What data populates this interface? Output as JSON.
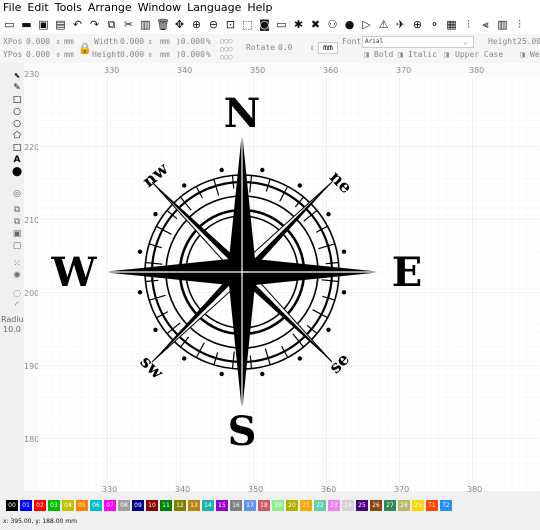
{
  "menu": [
    "File",
    "Edit",
    "Tools",
    "Arrange",
    "Window",
    "Language",
    "Help"
  ],
  "toolbar_icons": [
    "new-icon",
    "open-icon",
    "save-icon",
    "save-as-icon",
    "undo-icon",
    "redo-icon",
    "copy-icon",
    "cut-icon",
    "paste-icon",
    "delete-icon",
    "move-icon",
    "zoom-in-icon",
    "zoom-out-icon",
    "zoom-fit-icon",
    "select-icon",
    "camera-icon",
    "monitor-icon",
    "gear-icon",
    "tools-icon",
    "users-icon",
    "user-icon",
    "mirror-icon",
    "flip-icon",
    "send-icon",
    "target-icon",
    "list-icon",
    "grid-icon",
    "align-icon",
    "distribute-icon",
    "array-icon",
    "more-icon"
  ],
  "props": {
    "xpos_label": "XPos",
    "xpos_value": "0.000",
    "ypos_label": "YPos",
    "ypos_value": "0.000",
    "unit": "mm",
    "width_label": "Width",
    "width_value": "0.000",
    "height_label": "Height",
    "height_value": "0.000",
    "scale1": ")0.000",
    "scale2": ")0.000",
    "percent": "%",
    "rotate_label": "Rotate",
    "rotate_value": "0.0",
    "mm_button": "mm",
    "font_label": "Font",
    "font_value": "Arial",
    "fheight_label": "Height",
    "fheight_value": "25.00",
    "bold": "Bold",
    "italic": "Italic",
    "upper_case": "Upper Case",
    "welded": "We"
  },
  "left_tools": [
    "select-arrow-icon",
    "pen-icon",
    "rectangle-icon",
    "circle-icon",
    "ellipse-icon",
    "polygon-icon",
    "square-icon",
    "text-icon",
    "position-icon",
    "shape-icon",
    "copy-icon",
    "layers-icon",
    "group-icon",
    "ungroup-icon",
    "grid-array-icon",
    "radial-array-icon",
    "offset-icon",
    "corner-icon"
  ],
  "left_text": {
    "text_tool": "A",
    "radius_label": "Radius:",
    "radius_value": "10.0"
  },
  "ruler": {
    "x_ticks": [
      "330",
      "340",
      "350",
      "360",
      "370",
      "380"
    ],
    "y_ticks": [
      "230",
      "220",
      "210",
      "200",
      "190",
      "180"
    ]
  },
  "compass": {
    "north": "N",
    "south": "S",
    "east": "E",
    "west": "W",
    "nw": "nw",
    "ne": "ne",
    "sw": "sw",
    "se": "se"
  },
  "palette": {
    "labels": [
      "00",
      "01",
      "02",
      "03",
      "04",
      "05",
      "06",
      "07",
      "08",
      "09",
      "10",
      "11",
      "12",
      "13",
      "14",
      "15",
      "16",
      "17",
      "18",
      "19",
      "20",
      "21",
      "22",
      "23",
      "24",
      "25",
      "26",
      "27",
      "28",
      "29",
      "T1",
      "T2"
    ],
    "colors": [
      "#000000",
      "#0000ff",
      "#ff0000",
      "#00c000",
      "#c0c000",
      "#ff8000",
      "#00c0c0",
      "#ff00ff",
      "#a0a0a0",
      "#00008b",
      "#8b0000",
      "#008000",
      "#808000",
      "#b8860b",
      "#20b2aa",
      "#9400d3",
      "#808080",
      "#6495ed",
      "#cd5c5c",
      "#90ee90",
      "#b0b000",
      "#ffa500",
      "#66cdaa",
      "#ee82ee",
      "#d3d3d3",
      "#4b0082",
      "#8b4513",
      "#2e8b57",
      "#bdb76b",
      "#ffd700",
      "#ff4500",
      "#1e90ff"
    ]
  },
  "status": "x: 395.00, y: 188.00 mm"
}
